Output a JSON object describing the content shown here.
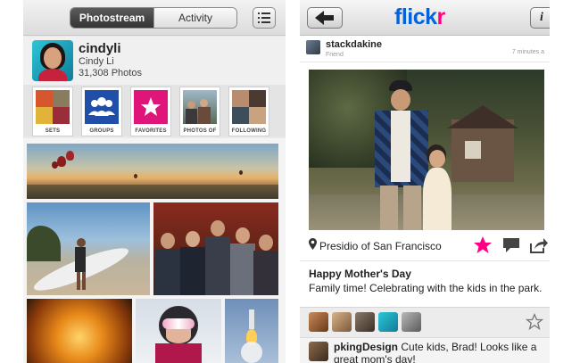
{
  "left_screen": {
    "tabs": [
      {
        "label": "Photostream",
        "active": true
      },
      {
        "label": "Activity",
        "active": false
      }
    ],
    "menu_icon": "list-icon",
    "profile": {
      "username": "cindyli",
      "display_name": "Cindy Li",
      "photo_count": "31,308 Photos"
    },
    "shortcuts": [
      {
        "label": "SETS",
        "icon": "sets-collage"
      },
      {
        "label": "GROUPS",
        "icon": "groups-icon"
      },
      {
        "label": "FAVORITES",
        "icon": "star-icon"
      },
      {
        "label": "PHOTOS OF",
        "icon": "people-photo"
      },
      {
        "label": "FOLLOWING",
        "icon": "faces-collage"
      }
    ],
    "photostream": [
      "balloons-over-valley",
      "surfer-carrying-board",
      "group-of-friends",
      "orange-lights",
      "kid-with-ski-goggles",
      "rocket-launch"
    ]
  },
  "right_screen": {
    "back_icon": "back-arrow-icon",
    "logo": {
      "part1": "flick",
      "part2": "r",
      "color1": "#0063dc",
      "color2": "#ff0084"
    },
    "info_label": "i",
    "post": {
      "author": "stackdakine",
      "relationship": "Friend",
      "time": "7 minutes a",
      "photo": "two-kids-in-garden",
      "location": "Presidio of San Francisco",
      "title": "Happy Mother's Day",
      "description": "Family time! Celebrating with the kids in the park.",
      "is_favorited": true,
      "favorite_color": "#ff0084"
    },
    "faves_avatars": 5,
    "comments": [
      {
        "user": "pkingDesign",
        "text": " Cute kids, Brad! Looks like a great mom's day!"
      }
    ]
  }
}
